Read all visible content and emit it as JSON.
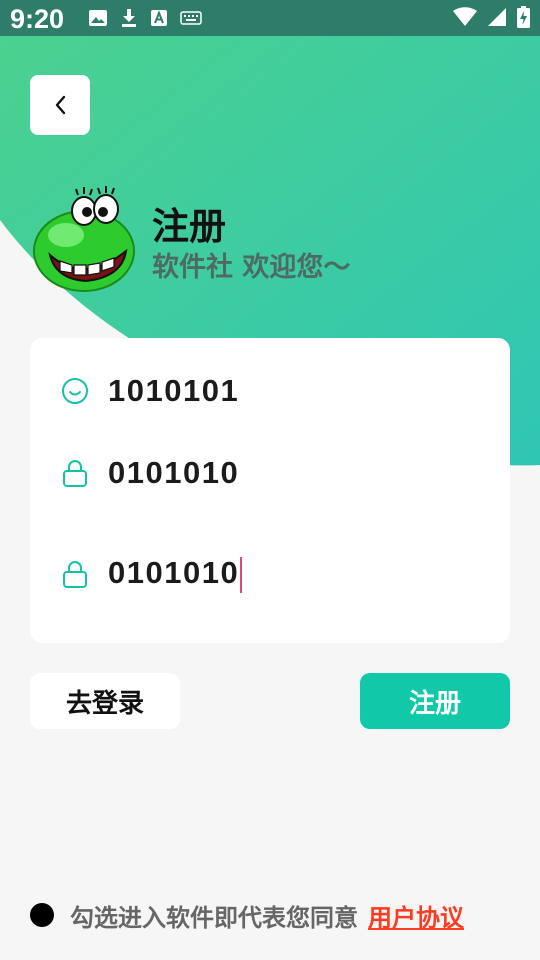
{
  "status_bar": {
    "time": "9:20",
    "left_icons": [
      "image-icon",
      "download-icon",
      "keyboard-a-icon",
      "keyboard-icon"
    ],
    "right_icons": [
      "wifi-icon",
      "signal-icon",
      "battery-charging-icon"
    ]
  },
  "header": {
    "back_icon": "chevron-left-icon",
    "title": "注册",
    "subtitle": "软件社 欢迎您～"
  },
  "form": {
    "username": {
      "icon": "smile-icon",
      "value": "1010101"
    },
    "password": {
      "icon": "lock-icon",
      "value": "0101010"
    },
    "confirm_password": {
      "icon": "lock-icon",
      "value": "0101010"
    }
  },
  "actions": {
    "login_label": "去登录",
    "register_label": "注册"
  },
  "agreement": {
    "text": "勾选进入软件即代表您同意",
    "link": "用户协议"
  },
  "colors": {
    "accent": "#11c9a8",
    "gradient_start": "#4bd18f",
    "gradient_end": "#2fc6b4",
    "link": "#ff3b1f",
    "caret": "#e0457b"
  }
}
